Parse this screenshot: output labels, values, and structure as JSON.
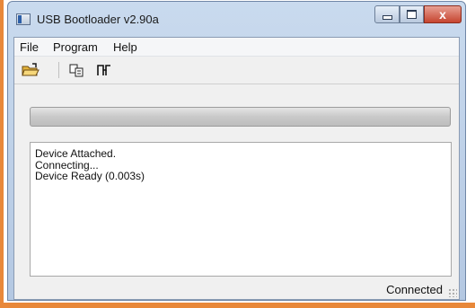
{
  "window": {
    "title": "USB Bootloader v2.90a",
    "controls": {
      "minimize": "minimize",
      "maximize": "maximize",
      "close": "x"
    }
  },
  "menubar": {
    "items": [
      {
        "label": "File"
      },
      {
        "label": "Program"
      },
      {
        "label": "Help"
      }
    ]
  },
  "toolbar": {
    "buttons": [
      {
        "icon": "open-folder-icon"
      },
      {
        "icon": "copy-pages-icon"
      },
      {
        "icon": "reset-connection-icon"
      }
    ]
  },
  "progress": {
    "value": 0
  },
  "log": {
    "lines": [
      "Device Attached.",
      "Connecting...",
      "Device Ready (0.003s)"
    ]
  },
  "status": {
    "text": "Connected"
  },
  "colors": {
    "accent_frame": "#e8883a",
    "close_button": "#c6442f",
    "titlebar": "#c9daee"
  }
}
